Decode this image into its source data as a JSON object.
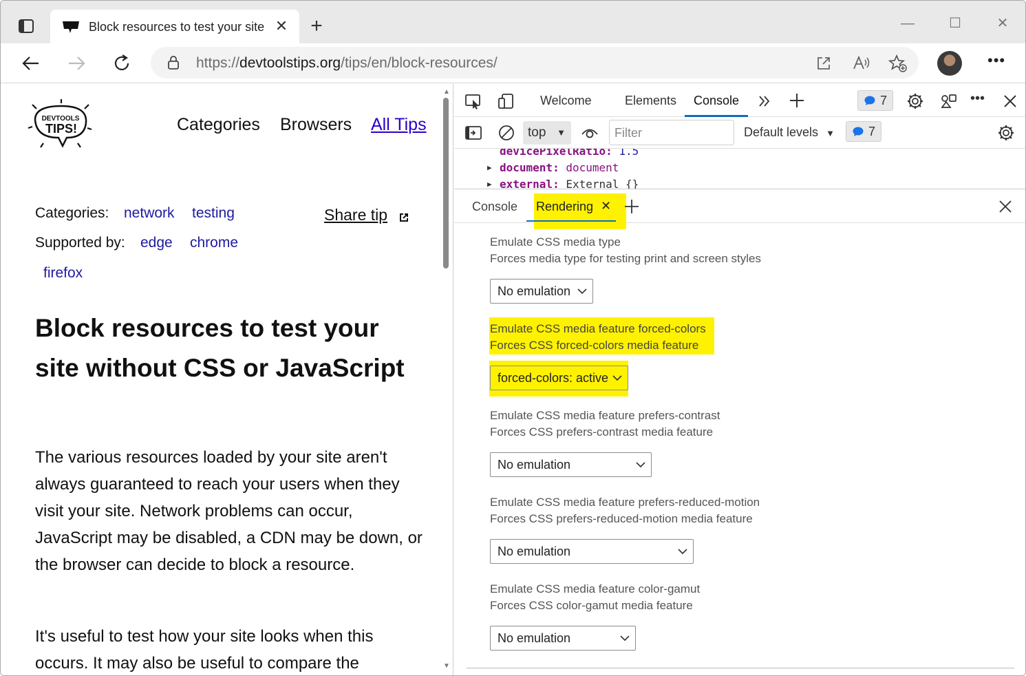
{
  "browser": {
    "tab_title": "Block resources to test your site without CSS or JavaScript",
    "tab_title_visible": "Block resources to test your site",
    "url_scheme": "https://",
    "url_host": "devtoolstips.org",
    "url_path": "/tips/en/block-resources/"
  },
  "page": {
    "logo_text_top": "DEVTOOLS",
    "logo_text_main": "TIPS!",
    "nav": [
      "Categories",
      "Browsers",
      "All Tips"
    ],
    "categories_label": "Categories:",
    "categories": [
      "network",
      "testing"
    ],
    "supported_label": "Supported by:",
    "supported": [
      "edge",
      "chrome",
      "firefox"
    ],
    "share_tip": "Share tip",
    "title": "Block resources to test your site without CSS or JavaScript",
    "paragraph1": "The various resources loaded by your site aren't always guaranteed to reach your users when they visit your site. Network problems can occur, JavaScript may be disabled, a CDN may be down, or the browser can decide to block a resource.",
    "paragraph2": "It's useful to test how your site looks when this occurs. It may also be useful to compare the"
  },
  "devtools": {
    "tabs": [
      "Welcome",
      "Elements",
      "Console"
    ],
    "active_tab": "Console",
    "issues_count": "7",
    "context": "top",
    "filter_placeholder": "Filter",
    "levels": "Default levels",
    "messages_count": "7",
    "console_lines": [
      {
        "key": "devicePixelRatio",
        "value": "1.5"
      },
      {
        "key": "document",
        "value": "document"
      },
      {
        "key": "external",
        "value": "External {}"
      }
    ],
    "drawer_tabs": [
      "Console",
      "Rendering"
    ],
    "active_drawer_tab": "Rendering",
    "highlight_color": "#fff200",
    "accent_color": "#0f6cbd",
    "rendering": [
      {
        "title": "Emulate CSS media type",
        "desc": "Forces media type for testing print and screen styles",
        "value": "No emulation"
      },
      {
        "title": "Emulate CSS media feature forced-colors",
        "desc": "Forces CSS forced-colors media feature",
        "value": "forced-colors: active"
      },
      {
        "title": "Emulate CSS media feature prefers-contrast",
        "desc": "Forces CSS prefers-contrast media feature",
        "value": "No emulation"
      },
      {
        "title": "Emulate CSS media feature prefers-reduced-motion",
        "desc": "Forces CSS prefers-reduced-motion media feature",
        "value": "No emulation"
      },
      {
        "title": "Emulate CSS media feature color-gamut",
        "desc": "Forces CSS color-gamut media feature",
        "value": "No emulation"
      }
    ]
  }
}
